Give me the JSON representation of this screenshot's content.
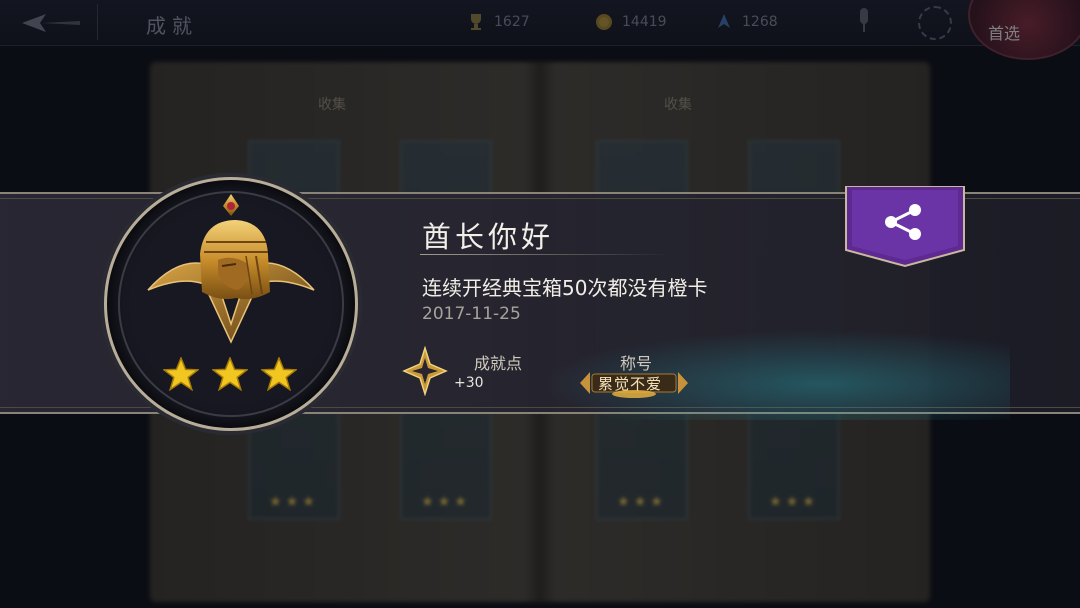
{
  "topbar": {
    "title": "成就",
    "trophy_count": "1627",
    "coin_count": "14419",
    "gem_count": "1268",
    "avatar_label": "首选"
  },
  "background": {
    "book_tab_left": "收集",
    "book_tab_right": "收集",
    "cards": [
      {
        "title": "",
        "stars": "★★★"
      },
      {
        "title": "",
        "stars": "★★★"
      },
      {
        "title": "",
        "stars": "★★★"
      },
      {
        "title": "",
        "stars": "★★★"
      }
    ]
  },
  "achievement": {
    "name": "酋长你好",
    "description": "连续开经典宝箱50次都没有橙卡",
    "date": "2017-11-25",
    "stars": 3,
    "points_label": "成就点",
    "points_value": "+30",
    "title_label": "称号",
    "title_value": "累觉不爱"
  },
  "colors": {
    "accent_gold": "#e6b33a",
    "share_purple": "#6a2fa0",
    "banner_border": "#8a8478"
  },
  "icons": [
    "back-arrow-icon",
    "trophy-icon",
    "coin-icon",
    "gem-icon",
    "microphone-icon",
    "settings-icon",
    "share-icon",
    "achievement-point-icon",
    "star-icon"
  ]
}
